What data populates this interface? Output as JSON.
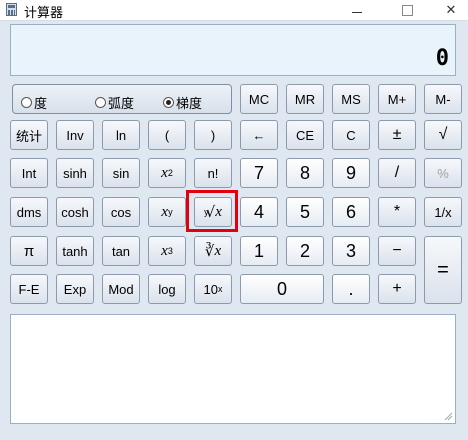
{
  "window": {
    "title": "计算器"
  },
  "display": {
    "value": "0"
  },
  "mode": {
    "options": [
      "度",
      "弧度",
      "梯度"
    ],
    "selected": "梯度"
  },
  "memory": [
    "MC",
    "MR",
    "MS",
    "M+",
    "M-"
  ],
  "buttons": {
    "stat": "统计",
    "inv": "Inv",
    "ln": "ln",
    "lparen": "(",
    "rparen": ")",
    "back": "←",
    "ce": "CE",
    "c": "C",
    "pm": "±",
    "sqrt": "√",
    "int": "Int",
    "sinh": "sinh",
    "sin": "sin",
    "x2_base": "x",
    "x2_exp": "2",
    "fact": "n!",
    "seven": "7",
    "eight": "8",
    "nine": "9",
    "div": "/",
    "pct": "%",
    "dms": "dms",
    "cosh": "cosh",
    "cos": "cos",
    "xy_base": "x",
    "xy_exp": "y",
    "yroot_idx": "y",
    "yroot_base": "x",
    "four": "4",
    "five": "5",
    "six": "6",
    "mul": "*",
    "recip": "1/x",
    "pi": "π",
    "tanh": "tanh",
    "tan": "tan",
    "x3_base": "x",
    "x3_exp": "3",
    "cbrt_sym": "∛",
    "cbrt_base": "x",
    "one": "1",
    "two": "2",
    "three": "3",
    "minus": "−",
    "fe": "F-E",
    "exp": "Exp",
    "mod": "Mod",
    "log": "log",
    "tenx_base": "10",
    "tenx_exp": "x",
    "zero": "0",
    "dot": ".",
    "plus": "+",
    "eq": "="
  },
  "colors": {
    "highlight": "#e0000f"
  }
}
